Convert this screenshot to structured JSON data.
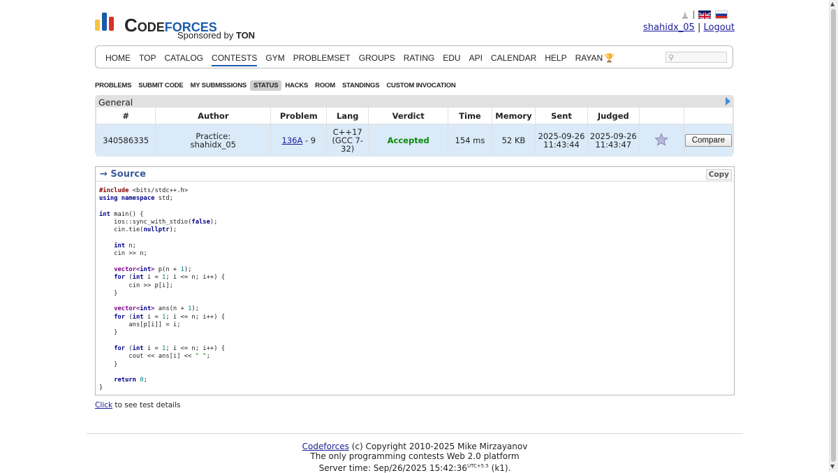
{
  "header": {
    "logo_word_1": "Code",
    "logo_word_2": "forces",
    "sponsor_prefix": "Sponsored by",
    "sponsor_name": "TON",
    "separator": "|",
    "username": "shahidx_05",
    "user_separator": "|",
    "logout": "Logout",
    "logo_bar_colors": [
      "#f6c43d",
      "#1a5cab",
      "#d9302b"
    ]
  },
  "menu": {
    "items": [
      "HOME",
      "TOP",
      "CATALOG",
      "CONTESTS",
      "GYM",
      "PROBLEMSET",
      "GROUPS",
      "RATING",
      "EDU",
      "API",
      "CALENDAR",
      "HELP",
      "RAYAN"
    ],
    "active": "CONTESTS",
    "search_placeholder": ""
  },
  "submenu": {
    "items": [
      "PROBLEMS",
      "SUBMIT CODE",
      "MY SUBMISSIONS",
      "STATUS",
      "HACKS",
      "ROOM",
      "STANDINGS",
      "CUSTOM INVOCATION"
    ],
    "selected": "STATUS"
  },
  "status": {
    "section_title": "General",
    "columns": [
      "#",
      "Author",
      "Problem",
      "Lang",
      "Verdict",
      "Time",
      "Memory",
      "Sent",
      "Judged",
      "",
      ""
    ],
    "row": {
      "id": "340586335",
      "author_line1": "Practice:",
      "author_line2": "shahidx_05",
      "problem_link": "136A",
      "problem_suffix": "- 9",
      "lang": "C++17 (GCC 7-32)",
      "verdict": "Accepted",
      "time": "154 ms",
      "memory": "52 KB",
      "sent": "2025-09-26 11:43:44",
      "judged": "2025-09-26 11:43:47",
      "compare_label": "Compare"
    },
    "accent_color": "#0a8a0a"
  },
  "source": {
    "title": "→ Source",
    "copy_label": "Copy",
    "lines": [
      "#include <bits/stdc++.h>",
      "using namespace std;",
      "",
      "int main() {",
      "    ios::sync_with_stdio(false);",
      "    cin.tie(nullptr);",
      "",
      "    int n;",
      "    cin >> n;",
      "",
      "    vector<int> p(n + 1);",
      "    for (int i = 1; i <= n; i++) {",
      "        cin >> p[i];",
      "    }",
      "",
      "    vector<int> ans(n + 1);",
      "    for (int i = 1; i <= n; i++) {",
      "        ans[p[i]] = i;",
      "    }",
      "",
      "    for (int i = 1; i <= n; i++) {",
      "        cout << ans[i] << \" \";",
      "    }",
      "",
      "    return 0;",
      "}"
    ]
  },
  "details": {
    "link": "Click",
    "text": "to see test details"
  },
  "footer": {
    "link": "Codeforces",
    "copyright": "(c) Copyright 2010-2025 Mike Mirzayanov",
    "tagline": "The only programming contests Web 2.0 platform",
    "server_time_prefix": "Server time: Sep/26/2025 15:42:36",
    "tz": "UTC+5.5",
    "server_suffix": "(k1)."
  }
}
